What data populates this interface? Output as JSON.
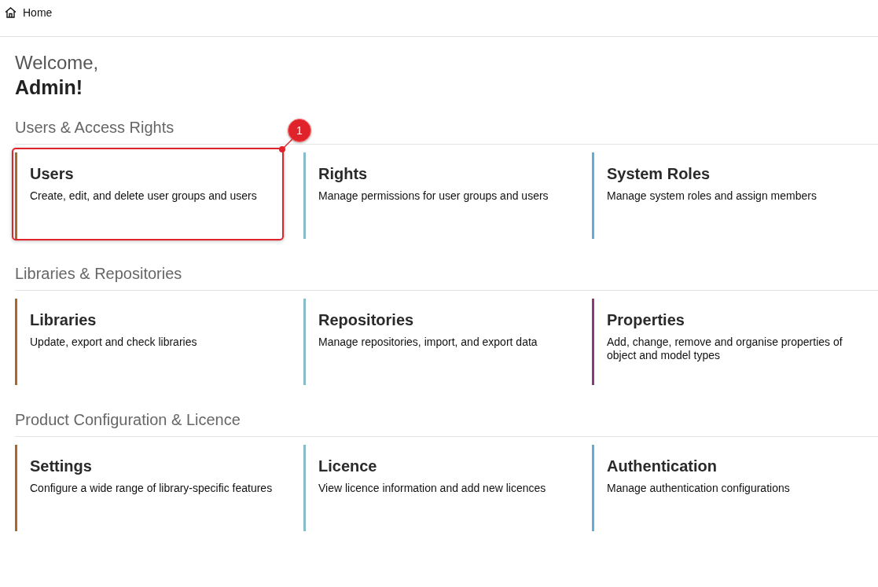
{
  "breadcrumb": {
    "label": "Home"
  },
  "greeting": {
    "line1": "Welcome,",
    "line2": "Admin!"
  },
  "annotation": {
    "number": "1"
  },
  "sections": [
    {
      "title": "Users & Access Rights",
      "cards": [
        {
          "title": "Users",
          "description": "Create, edit, and delete user groups and users",
          "color": "#a8692a",
          "highlighted": true
        },
        {
          "title": "Rights",
          "description": "Manage permissions for user groups and users",
          "color": "#86bccb",
          "highlighted": false
        },
        {
          "title": "System Roles",
          "description": "Manage system roles and assign members",
          "color": "#5eaed8",
          "highlighted": false
        }
      ]
    },
    {
      "title": "Libraries & Repositories",
      "cards": [
        {
          "title": "Libraries",
          "description": "Update, export and check libraries",
          "color": "#a8692a",
          "highlighted": false
        },
        {
          "title": "Repositories",
          "description": "Manage repositories, import, and export data",
          "color": "#86bccb",
          "highlighted": false
        },
        {
          "title": "Properties",
          "description": "Add, change, remove and organise properties of object and model types",
          "color": "#8e3a78",
          "highlighted": false
        }
      ]
    },
    {
      "title": "Product Configuration & Licence",
      "cards": [
        {
          "title": "Settings",
          "description": "Configure a wide range of library-specific features",
          "color": "#a8692a",
          "highlighted": false
        },
        {
          "title": "Licence",
          "description": "View licence information and add new licences",
          "color": "#86bccb",
          "highlighted": false
        },
        {
          "title": "Authentication",
          "description": "Manage authentication configurations",
          "color": "#5eaed8",
          "highlighted": false
        }
      ]
    }
  ]
}
